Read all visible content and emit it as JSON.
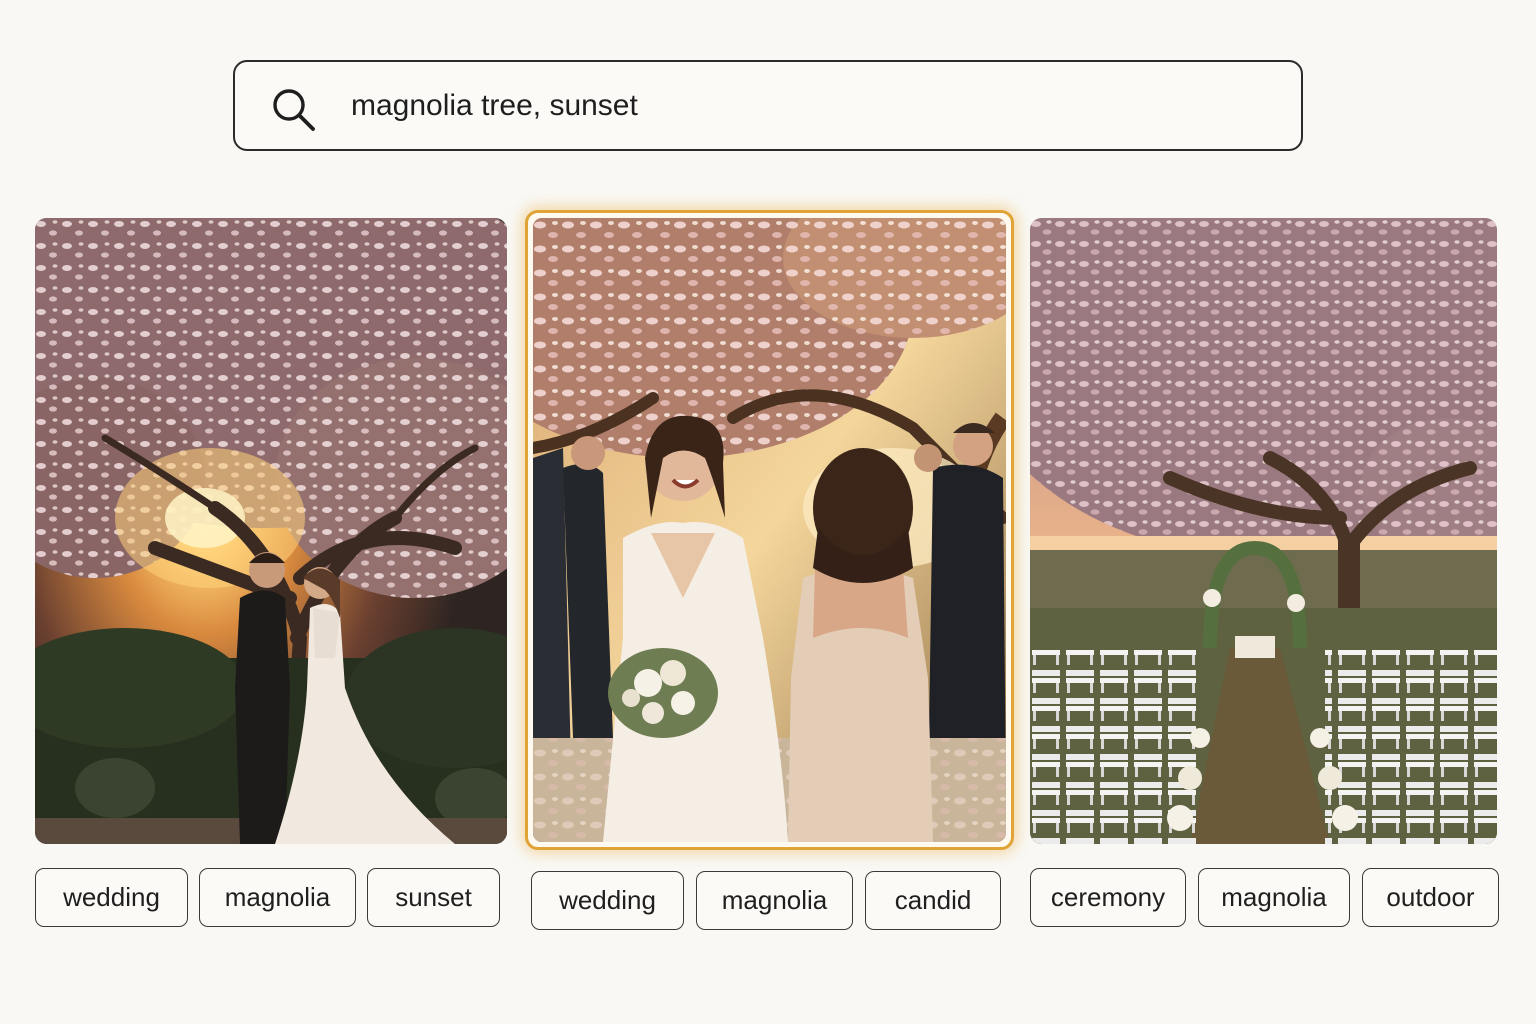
{
  "search": {
    "icon": "search-icon",
    "query": "magnolia tree, sunset"
  },
  "results": [
    {
      "scene": "couple embracing under blooming magnolia tree at sunset",
      "selected": false,
      "tags": [
        "wedding",
        "magnolia",
        "sunset"
      ]
    },
    {
      "scene": "laughing bride with bouquet talking with bridesmaid under magnolia tree",
      "selected": true,
      "tags": [
        "wedding",
        "magnolia",
        "candid"
      ]
    },
    {
      "scene": "outdoor ceremony with white chairs, floral arch and magnolia tree",
      "selected": false,
      "tags": [
        "ceremony",
        "magnolia",
        "outdoor"
      ]
    }
  ],
  "colors": {
    "background": "#f9f8f4",
    "selected_border": "#e0a336",
    "text": "#1f1f1f"
  }
}
